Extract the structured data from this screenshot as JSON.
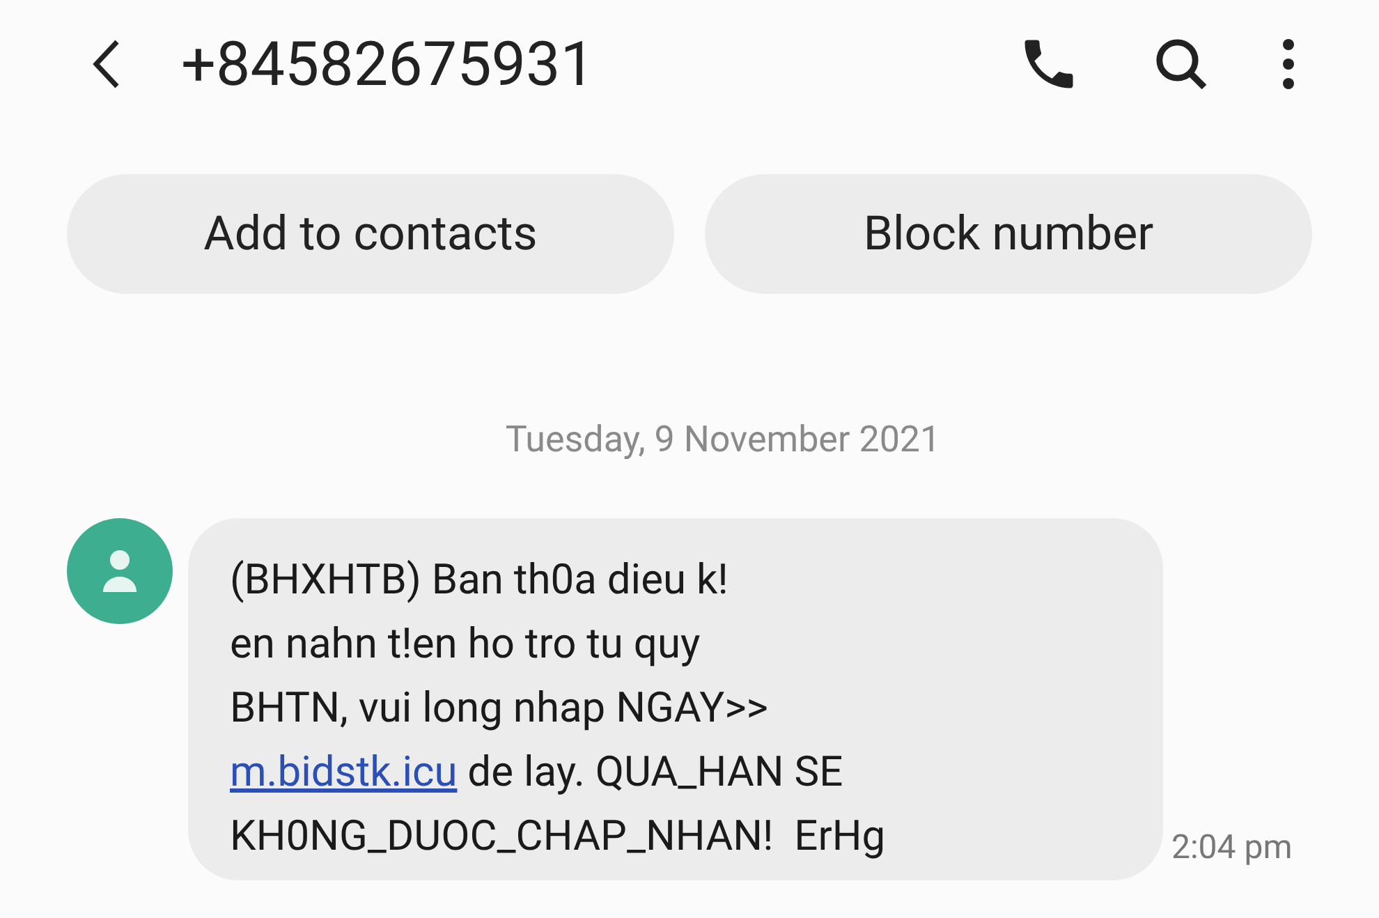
{
  "header": {
    "title": "+84582675931"
  },
  "actions": [
    {
      "label": "Add to contacts"
    },
    {
      "label": "Block number"
    }
  ],
  "date": "Tuesday, 9 November 2021",
  "message": {
    "text_before_link": "(BHXHTB) Ban th0a dieu k!\nen nahn t!en ho tro tu quy\nBHTN, vui long nhap NGAY>>\n",
    "link": "m.bidstk.icu",
    "text_after_link": " de lay. QUA_HAN SE\nKH0NG_DUOC_CHAP_NHAN!  ErHg",
    "time": "2:04 pm"
  }
}
